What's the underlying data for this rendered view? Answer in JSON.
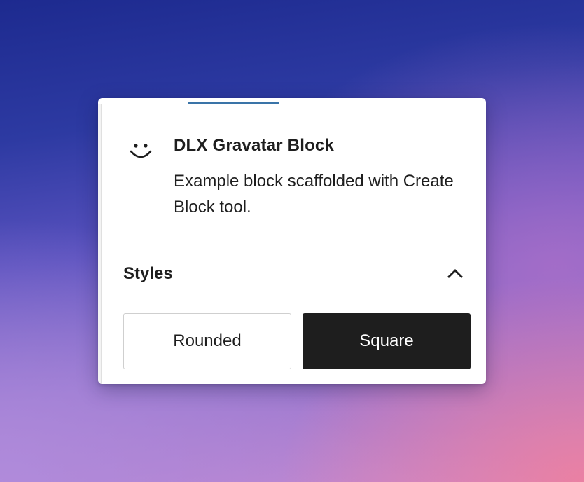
{
  "block": {
    "icon": "smiley-icon",
    "title": "DLX Gravatar Block",
    "description": "Example block scaffolded with Create Block tool."
  },
  "styles": {
    "title": "Styles",
    "toggle_icon": "chevron-up-icon",
    "options": [
      {
        "label": "Rounded",
        "selected": false
      },
      {
        "label": "Square",
        "selected": true
      }
    ]
  },
  "colors": {
    "accent": "#3a74a8",
    "selected_bg": "#1e1e1e",
    "text": "#1e1e1e"
  }
}
